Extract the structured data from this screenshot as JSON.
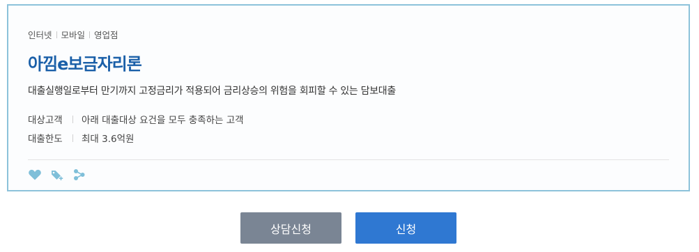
{
  "product": {
    "channels": [
      "인터넷",
      "모바일",
      "영업점"
    ],
    "title": "아낌e보금자리론",
    "description": "대출실행일로부터 만기까지 고정금리가 적용되어 금리상승의 위험을 회피할 수 있는 담보대출",
    "info": [
      {
        "label": "대상고객",
        "value": "아래 대출대상 요건을 모두 충족하는 고객"
      },
      {
        "label": "대출한도",
        "value": "최대 3.6억원"
      }
    ]
  },
  "icons": [
    "heart-icon",
    "tag-add-icon",
    "share-icon"
  ],
  "buttons": {
    "consult_label": "상담신청",
    "apply_label": "신청"
  },
  "colors": {
    "title": "#1a5fa8",
    "card_border": "#8cc2da",
    "icon": "#7fbfd9",
    "consult_button": "#7a8594",
    "apply_button": "#2f78d2"
  }
}
